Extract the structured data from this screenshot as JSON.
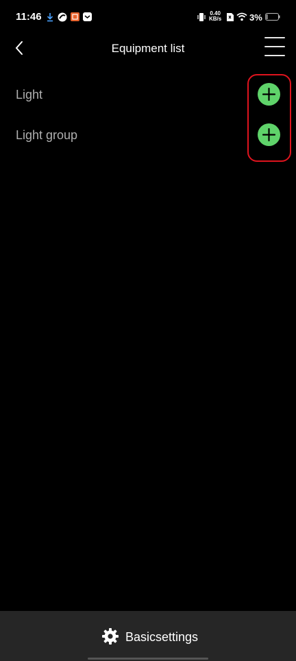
{
  "status_bar": {
    "time": "11:46",
    "network_speed_value": "0.40",
    "network_speed_unit": "KB/s",
    "battery": "3%",
    "icons": [
      "download-icon",
      "app-notification-icon",
      "app-notification-icon",
      "app-notification-icon",
      "vibrate-icon",
      "wifi-icon",
      "battery-icon"
    ]
  },
  "header": {
    "title": "Equipment list",
    "back_icon": "chevron-left-icon",
    "menu_icon": "hamburger-menu-icon"
  },
  "list": {
    "items": [
      {
        "label": "Light",
        "action_icon": "plus-circle-icon"
      },
      {
        "label": "Light group",
        "action_icon": "plus-circle-icon"
      }
    ]
  },
  "bottom_bar": {
    "settings_label": "Basicsettings",
    "settings_icon": "gear-icon"
  },
  "colors": {
    "background": "#000000",
    "accent_green": "#5fd36a",
    "highlight_red": "#e0141e",
    "bottom_bar": "#262626"
  }
}
